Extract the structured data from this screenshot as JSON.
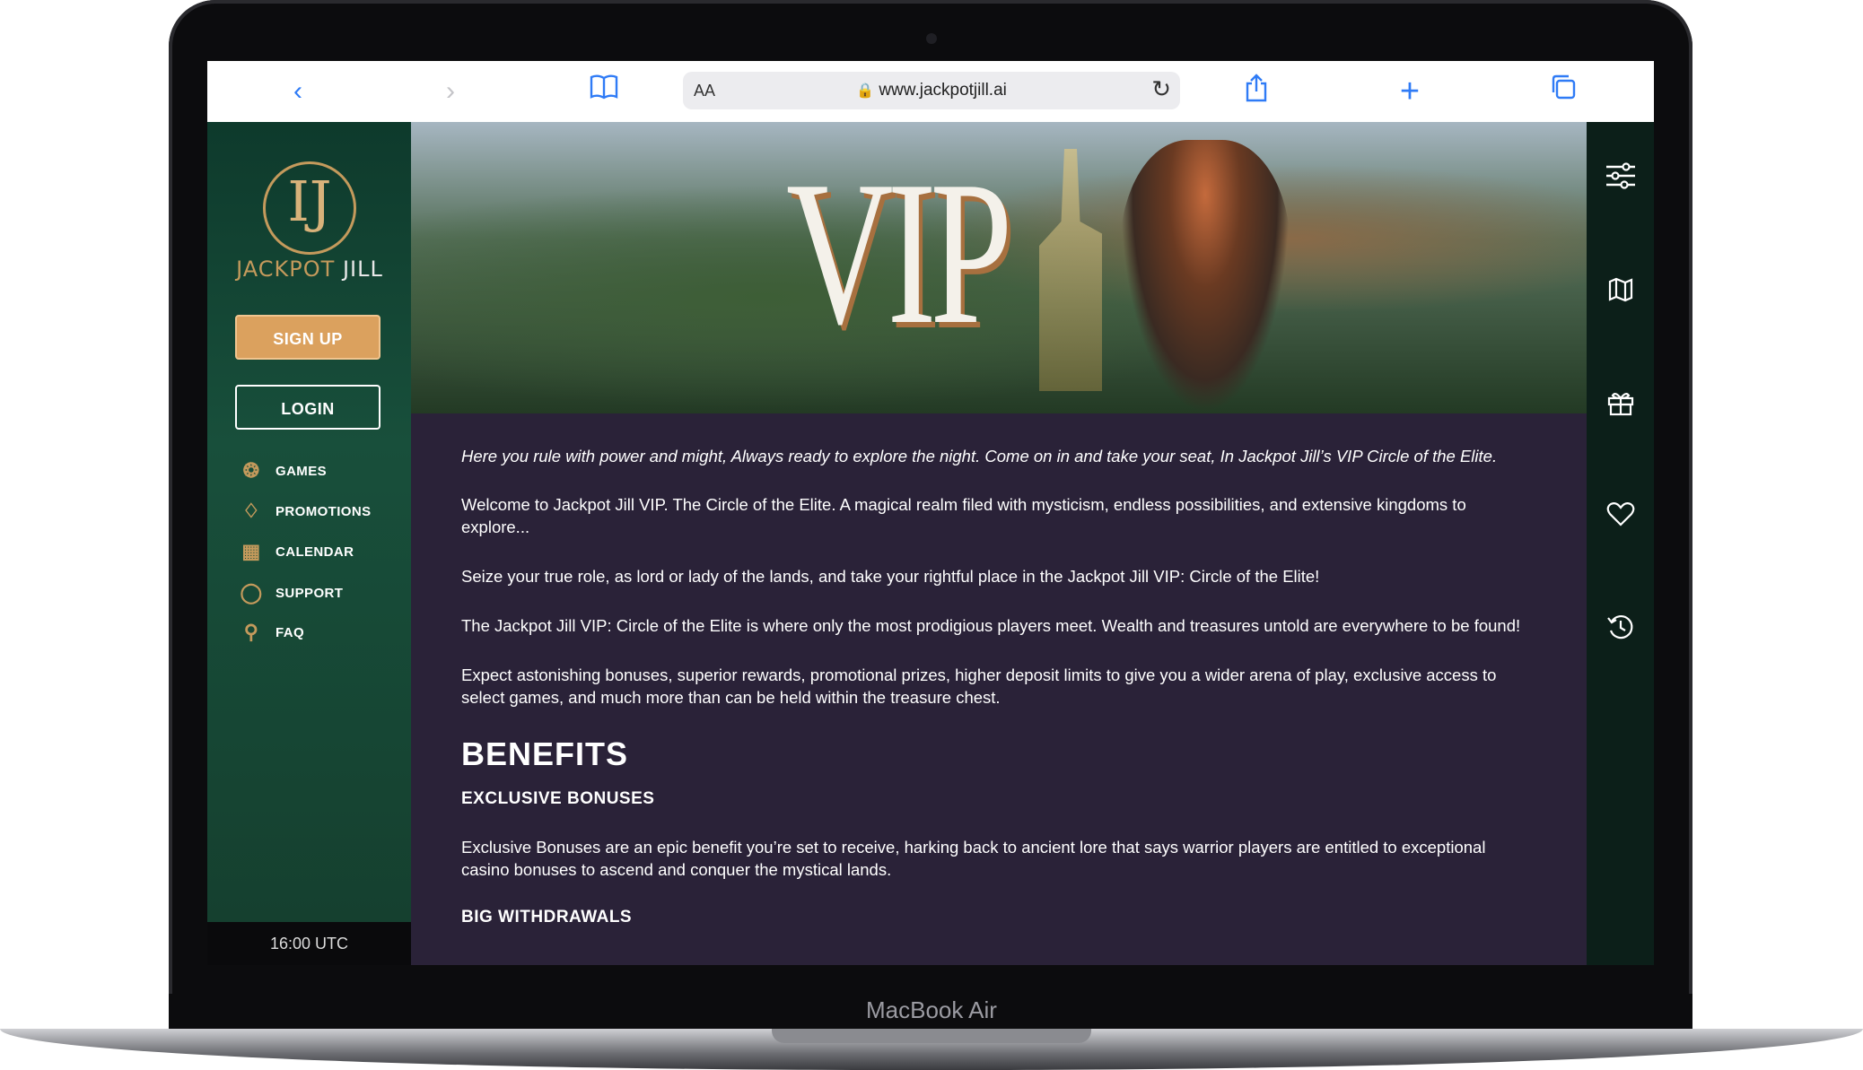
{
  "device": {
    "model_label": "MacBook Air"
  },
  "browser": {
    "aa_label": "AA",
    "url": "www.jackpotjill.ai",
    "icons": [
      "back-icon",
      "forward-icon",
      "bookmarks-icon",
      "lock-icon",
      "reload-icon",
      "share-icon",
      "new-tab-icon",
      "tabs-icon"
    ]
  },
  "sidebar": {
    "logo": {
      "monogram": "IJ",
      "brand_word1": "JACKPOT",
      "brand_word2": "JILL"
    },
    "signup_label": "SIGN UP",
    "login_label": "LOGIN",
    "nav": [
      {
        "label": "GAMES",
        "icon": "chip-icon"
      },
      {
        "label": "PROMOTIONS",
        "icon": "diamond-icon"
      },
      {
        "label": "CALENDAR",
        "icon": "calendar-icon"
      },
      {
        "label": "SUPPORT",
        "icon": "chat-bubble-icon"
      },
      {
        "label": "FAQ",
        "icon": "faq-search-icon"
      }
    ],
    "time": "16:00 UTC"
  },
  "rail": {
    "icons": [
      "filters-icon",
      "map-icon",
      "gift-icon",
      "heart-icon",
      "history-icon"
    ]
  },
  "hero": {
    "title": "VIP"
  },
  "content": {
    "intro": "Here you rule with power and might, Always ready to explore the night. Come on in and take your seat, In Jackpot Jill’s VIP Circle of the Elite.",
    "p1": "Welcome to Jackpot Jill VIP. The Circle of the Elite. A magical realm filed with mysticism, endless possibilities, and extensive kingdoms to explore...",
    "p2": "Seize your true role, as lord or lady of the lands, and take your rightful place in the Jackpot Jill VIP: Circle of the Elite!",
    "p3": "The Jackpot Jill VIP: Circle of the Elite is where only the most prodigious players meet. Wealth and treasures untold are everywhere to be found!",
    "p4": "Expect astonishing bonuses, superior rewards, promotional prizes, higher deposit limits to give you a wider arena of play, exclusive access to select games, and much more than can be held within the treasure chest.",
    "benefits_heading": "BENEFITS",
    "bonuses_heading": "EXCLUSIVE BONUSES",
    "bonuses_text": "Exclusive Bonuses are an epic benefit you’re set to receive, harking back to ancient lore that says warrior players are entitled to exceptional casino bonuses to ascend and conquer the mystical lands.",
    "withdrawals_heading": "BIG WITHDRAWALS"
  },
  "colors": {
    "accent_gold": "#dba15e",
    "sidebar_green": "#184f3b",
    "content_bg": "#2a2238",
    "browser_blue": "#2f7bf6"
  }
}
